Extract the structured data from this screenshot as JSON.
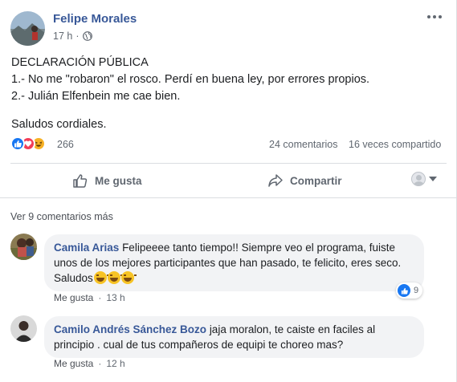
{
  "post": {
    "author": "Felipe Morales",
    "time": "17 h",
    "visibility_icon": "globe-icon",
    "text_lines": [
      "DECLARACIÓN PÚBLICA",
      "1.- No me \"robaron\" el rosco. Perdí en buena ley, por errores propios.",
      "2.- Julián Elfenbein me cae bien."
    ],
    "closing": "Saludos cordiales.",
    "reactions": {
      "types": [
        "like-icon",
        "love-icon",
        "haha-icon"
      ],
      "count": "266"
    },
    "comments_count": "24 comentarios",
    "shares_count": "16 veces compartido"
  },
  "actions": {
    "like_label": "Me gusta",
    "share_label": "Compartir"
  },
  "comments": {
    "view_more": "Ver 9 comentarios más",
    "items": [
      {
        "name": "Camila Arias",
        "text": "Felipeeee tanto tiempo!! Siempre veo el programa, fuiste unos de los mejores participantes que han pasado, te felicito, eres seco. Saludos",
        "like_label": "Me gusta",
        "time": "13 h",
        "reaction_count": "9"
      },
      {
        "name": "Camilo Andrés Sánchez Bozo",
        "text": "jaja moralon, te caiste en faciles al principio . cual de tus compañeros de equipi te choreo mas?",
        "like_label": "Me gusta",
        "time": "12 h"
      }
    ]
  },
  "colors": {
    "name_link": "#385898",
    "like_blue": "#1877f2",
    "love_red": "#f33e58",
    "haha_yellow": "#f7b125",
    "bubble_bg": "#f2f3f5",
    "muted_text": "#606770"
  }
}
